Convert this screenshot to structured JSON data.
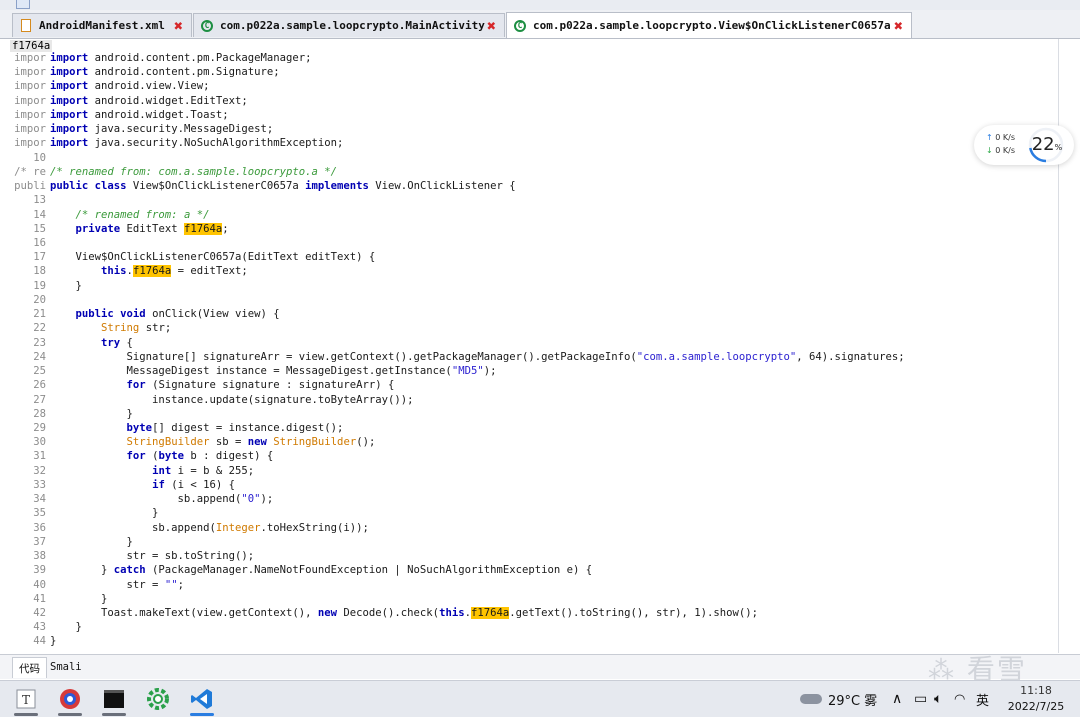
{
  "tabs": [
    {
      "label": "AndroidManifest.xml",
      "icon": "xml-file-icon",
      "active": false
    },
    {
      "label": "com.p022a.sample.loopcrypto.MainActivity",
      "icon": "class-icon",
      "active": false
    },
    {
      "label": "com.p022a.sample.loopcrypto.View$OnClickListenerC0657a",
      "icon": "class-icon",
      "active": true
    }
  ],
  "editor": {
    "top_label": "f1764a",
    "lines": [
      {
        "gutter": "impor",
        "html": "<span class=\"kw\">import</span> android.content.pm.PackageManager;"
      },
      {
        "gutter": "impor",
        "html": "<span class=\"kw\">import</span> android.content.pm.Signature;"
      },
      {
        "gutter": "impor",
        "html": "<span class=\"kw\">import</span> android.view.View;"
      },
      {
        "gutter": "impor",
        "html": "<span class=\"kw\">import</span> android.widget.EditText;"
      },
      {
        "gutter": "impor",
        "html": "<span class=\"kw\">import</span> android.widget.Toast;"
      },
      {
        "gutter": "impor",
        "html": "<span class=\"kw\">import</span> java.security.MessageDigest;"
      },
      {
        "gutter": "impor",
        "html": "<span class=\"kw\">import</span> java.security.NoSuchAlgorithmException;"
      },
      {
        "gutter": "10",
        "html": ""
      },
      {
        "gutter": "/* re",
        "html": "<span class=\"cm\">/* renamed from: com.a.sample.loopcrypto.a */</span>"
      },
      {
        "gutter": "publi",
        "html": "<span class=\"kw\">public class</span> View$OnClickListenerC0657a <span class=\"kw\">implements</span> View.OnClickListener {"
      },
      {
        "gutter": "13",
        "html": ""
      },
      {
        "gutter": "14",
        "html": "    <span class=\"cm\">/* renamed from: a */</span>"
      },
      {
        "gutter": "15",
        "html": "    <span class=\"kw\">private</span> EditText <span class=\"hl\">f1764a</span>;"
      },
      {
        "gutter": "16",
        "html": ""
      },
      {
        "gutter": "17",
        "html": "    View$OnClickListenerC0657a(EditText editText) {"
      },
      {
        "gutter": "18",
        "html": "        <span class=\"kw\">this</span>.<span class=\"hl\">f1764a</span> = editText;"
      },
      {
        "gutter": "19",
        "html": "    }"
      },
      {
        "gutter": "20",
        "html": ""
      },
      {
        "gutter": "21",
        "html": "    <span class=\"kw\">public void</span> onClick(View view) {"
      },
      {
        "gutter": "22",
        "html": "        <span class=\"ty\">String</span> str;"
      },
      {
        "gutter": "23",
        "html": "        <span class=\"kw\">try</span> {"
      },
      {
        "gutter": "24",
        "html": "            Signature[] signatureArr = view.getContext().getPackageManager().getPackageInfo(<span class=\"st\">\"com.a.sample.loopcrypto\"</span>, 64).signatures;"
      },
      {
        "gutter": "25",
        "html": "            MessageDigest instance = MessageDigest.getInstance(<span class=\"st\">\"MD5\"</span>);"
      },
      {
        "gutter": "26",
        "html": "            <span class=\"kw\">for</span> (Signature signature : signatureArr) {"
      },
      {
        "gutter": "27",
        "html": "                instance.update(signature.toByteArray());"
      },
      {
        "gutter": "28",
        "html": "            }"
      },
      {
        "gutter": "29",
        "html": "            <span class=\"kw\">byte</span>[] digest = instance.digest();"
      },
      {
        "gutter": "30",
        "html": "            <span class=\"ty\">StringBuilder</span> sb = <span class=\"kw\">new</span> <span class=\"ty\">StringBuilder</span>();"
      },
      {
        "gutter": "31",
        "html": "            <span class=\"kw\">for</span> (<span class=\"kw\">byte</span> b : digest) {"
      },
      {
        "gutter": "32",
        "html": "                <span class=\"kw\">int</span> i = b &amp; 255;"
      },
      {
        "gutter": "33",
        "html": "                <span class=\"kw\">if</span> (i &lt; 16) {"
      },
      {
        "gutter": "34",
        "html": "                    sb.append(<span class=\"st\">\"0\"</span>);"
      },
      {
        "gutter": "35",
        "html": "                }"
      },
      {
        "gutter": "36",
        "html": "                sb.append(<span class=\"ty\">Integer</span>.toHexString(i));"
      },
      {
        "gutter": "37",
        "html": "            }"
      },
      {
        "gutter": "38",
        "html": "            str = sb.toString();"
      },
      {
        "gutter": "39",
        "html": "        } <span class=\"kw\">catch</span> (PackageManager.NameNotFoundException | NoSuchAlgorithmException e) {"
      },
      {
        "gutter": "40",
        "html": "            str = <span class=\"st\">\"\"</span>;"
      },
      {
        "gutter": "41",
        "html": "        }"
      },
      {
        "gutter": "42",
        "html": "        Toast.makeText(view.getContext(), <span class=\"kw\">new</span> Decode().check(<span class=\"kw\">this</span>.<span class=\"hl\">f1764a</span>.getText().toString(), str), 1).show();"
      },
      {
        "gutter": "43",
        "html": "    }"
      },
      {
        "gutter": "44",
        "html": "}"
      }
    ]
  },
  "bottom_tabs": [
    {
      "label": "代码",
      "active": true
    },
    {
      "label": "Smali",
      "active": false
    }
  ],
  "net_widget": {
    "upload": "0  K/s",
    "download": "0  K/s",
    "percent": "22",
    "percent_unit": "%",
    "percent_value": 22
  },
  "taskbar": {
    "apps": [
      "text-editor-icon",
      "browser-icon",
      "terminal-icon",
      "settings-gear-icon",
      "vscode-icon"
    ],
    "weather": "29°C 雾",
    "ime": "英",
    "time": "11:18",
    "date": "2022/7/25"
  },
  "watermark": "看雪"
}
